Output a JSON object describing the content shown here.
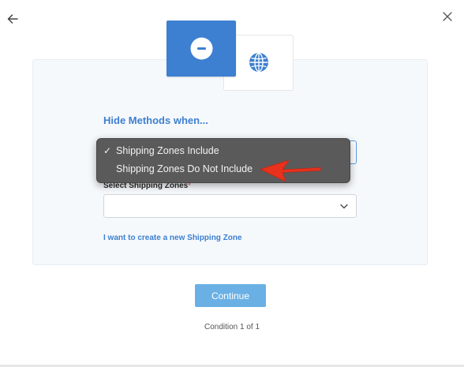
{
  "nav": {
    "back_icon": "arrow-left-icon",
    "close_icon": "close-icon"
  },
  "type_tiles": {
    "hide": {
      "icon": "minus-circle-icon",
      "color": "#3d7fd0"
    },
    "global": {
      "icon": "globe-icon",
      "color": "#3d7fd0"
    }
  },
  "form": {
    "title": "Hide Methods when...",
    "condition_dropdown": {
      "options": [
        {
          "label": "Shipping Zones Include",
          "checked": true
        },
        {
          "label": "Shipping Zones Do Not Include",
          "checked": false
        }
      ],
      "check_mark": "✓"
    },
    "zones_label": "Select Shipping Zones",
    "required_mark": "*",
    "zones_select_value": "",
    "create_zone_link": "I want to create a new Shipping Zone"
  },
  "footer": {
    "continue_label": "Continue",
    "condition_count": "Condition 1 of 1"
  },
  "colors": {
    "accent": "#3d7fd0",
    "button": "#6ab0e4",
    "annotation_arrow": "#e8321e"
  }
}
